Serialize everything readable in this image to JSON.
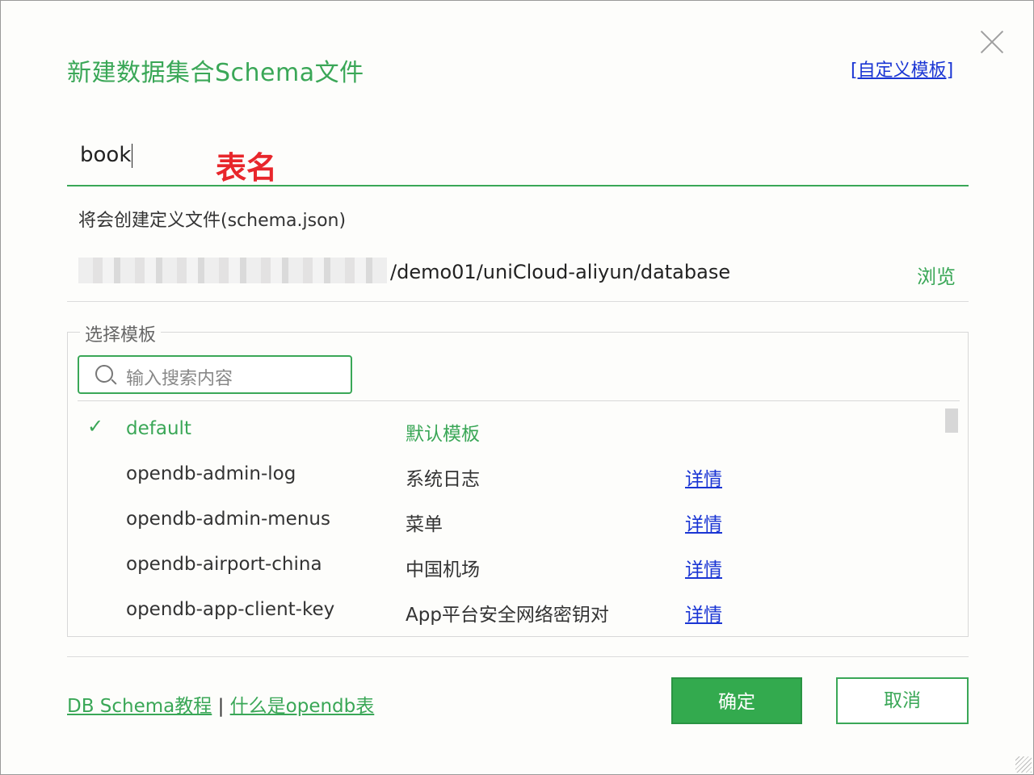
{
  "dialog": {
    "title": "新建数据集合Schema文件",
    "custom_template_link": "[自定义模板]",
    "table_name_value": "book",
    "annotation": "表名",
    "will_create_text": "将会创建定义文件(schema.json)",
    "path_suffix": "/demo01/uniCloud-aliyun/database",
    "browse_label": "浏览"
  },
  "templates": {
    "legend": "选择模板",
    "search_placeholder": "输入搜索内容",
    "items": [
      {
        "name": "default",
        "desc": "默认模板",
        "detail": "",
        "selected": true
      },
      {
        "name": "opendb-admin-log",
        "desc": "系统日志",
        "detail": "详情",
        "selected": false
      },
      {
        "name": "opendb-admin-menus",
        "desc": "菜单",
        "detail": "详情",
        "selected": false
      },
      {
        "name": "opendb-airport-china",
        "desc": "中国机场",
        "detail": "详情",
        "selected": false
      },
      {
        "name": "opendb-app-client-key",
        "desc": "App平台安全网络密钥对",
        "detail": "详情",
        "selected": false
      }
    ]
  },
  "footer": {
    "tutorial_link": "DB Schema教程",
    "separator": "|",
    "opendb_link": "什么是opendb表",
    "ok_label": "确定",
    "cancel_label": "取消"
  },
  "colors": {
    "accent": "#3aa757",
    "link": "#1a35d4",
    "annotation": "#e8262b"
  }
}
